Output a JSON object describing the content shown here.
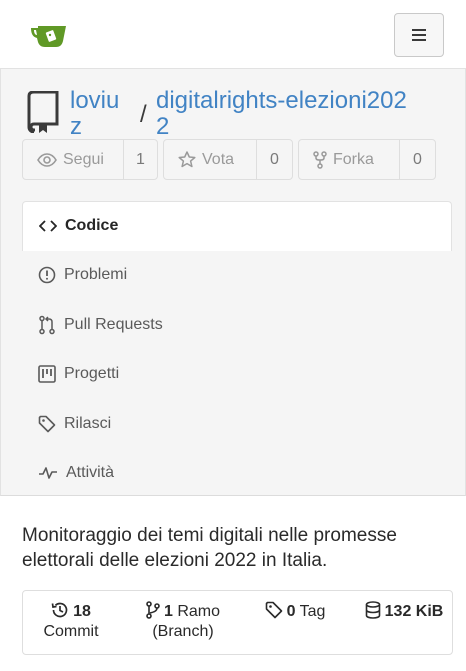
{
  "colors": {
    "brand_green": "#609926",
    "link_blue": "#4183c4",
    "header_bg": "#f5f5f5"
  },
  "topbar": {
    "logo_icon": "gitea-teacup-icon",
    "menu_icon": "hamburger-menu-icon"
  },
  "repo": {
    "icon": "book-icon",
    "owner_line1": "loviu",
    "owner_line2": "z",
    "separator": "/",
    "name_line1": "digitalrights-elezioni202",
    "name_line2": "2"
  },
  "actions": {
    "watch": {
      "icon": "eye-icon",
      "label": "Segui",
      "count": "1"
    },
    "star": {
      "icon": "star-icon",
      "label": "Vota",
      "count": "0"
    },
    "fork": {
      "icon": "fork-icon",
      "label": "Forka",
      "count": "0"
    }
  },
  "tabs": [
    {
      "icon": "code-icon",
      "label": "Codice",
      "active": true
    },
    {
      "icon": "issue-icon",
      "label": "Problemi"
    },
    {
      "icon": "pull-request-icon",
      "label": "Pull Requests"
    },
    {
      "icon": "project-icon",
      "label": "Progetti"
    },
    {
      "icon": "tag-icon",
      "label": "Rilasci"
    },
    {
      "icon": "pulse-icon",
      "label": "Attività"
    }
  ],
  "description": "Monitoraggio dei temi digitali nelle promesse elettorali delle elezioni 2022 in Italia.",
  "stats": {
    "commits": {
      "icon": "history-icon",
      "count": "18",
      "label": "Commit"
    },
    "branches": {
      "icon": "branch-icon",
      "count": "1",
      "label_line1": "Ramo",
      "label_line2": "(Branch)"
    },
    "tags": {
      "icon": "tag-icon",
      "count": "0",
      "label": "Tag"
    },
    "size": {
      "icon": "database-icon",
      "value": "132 KiB"
    }
  }
}
